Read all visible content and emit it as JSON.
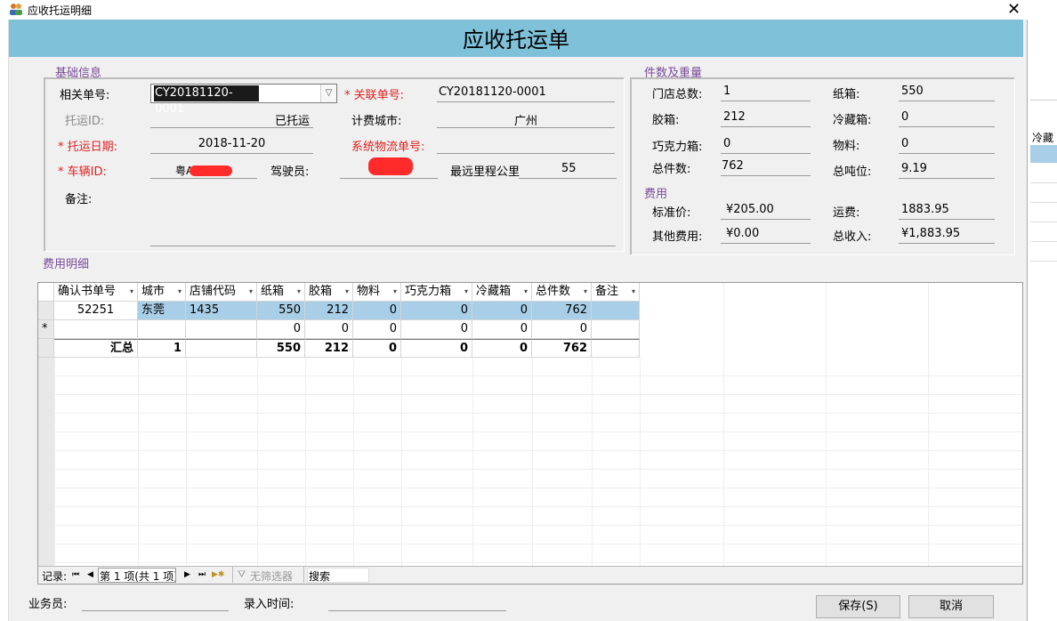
{
  "window": {
    "title": "应收托运明细",
    "close": "✕"
  },
  "header": {
    "title": "应收托运单"
  },
  "basic": {
    "section": "基础信息",
    "related_no_label": "相关单号:",
    "related_no_value": "CY20181120-0001",
    "linked_no_label": "* 关联单号:",
    "linked_no_value": "CY20181120-0001",
    "ship_id_label": "托运ID:",
    "ship_id_value": "已托运",
    "billing_city_label": "计费城市:",
    "billing_city_value": "广州",
    "ship_date_label": "* 托运日期:",
    "ship_date_value": "2018-11-20",
    "logistics_no_label": "系统物流单号:",
    "logistics_no_value": "",
    "vehicle_label": "* 车辆ID:",
    "vehicle_value": "粤A",
    "driver_label": "驾驶员:",
    "driver_value": "",
    "max_km_label": "最远里程公里",
    "max_km_value": "55",
    "remark_label": "备注:",
    "remark_value": ""
  },
  "pieces": {
    "section": "件数及重量",
    "store_total_label": "门店总数:",
    "store_total": "1",
    "carton_label": "纸箱:",
    "carton": "550",
    "rubber_label": "胶箱:",
    "rubber": "212",
    "cold_label": "冷藏箱:",
    "cold": "0",
    "choco_label": "巧克力箱:",
    "choco": "0",
    "material_label": "物料:",
    "material": "0",
    "total_pcs_label": "总件数:",
    "total_pcs": "762",
    "total_ton_label": "总吨位:",
    "total_ton": "9.19"
  },
  "fees": {
    "section": "费用",
    "std_price_label": "标准价:",
    "std_price": "¥205.00",
    "freight_label": "运费:",
    "freight": "1883.95",
    "other_label": "其他费用:",
    "other": "¥0.00",
    "total_income_label": "总收入:",
    "total_income": "¥1,883.95"
  },
  "detail": {
    "section": "费用明细",
    "columns": [
      "确认书单号",
      "城市",
      "店铺代码",
      "纸箱",
      "胶箱",
      "物料",
      "巧克力箱",
      "冷藏箱",
      "总件数",
      "备注"
    ],
    "row1": [
      "52251",
      "东莞",
      "1435",
      "550",
      "212",
      "0",
      "0",
      "0",
      "762",
      ""
    ],
    "new_row_marker": "*",
    "new_row": [
      "",
      "",
      "",
      "0",
      "0",
      "0",
      "0",
      "0",
      "0",
      ""
    ],
    "total_label": "汇总",
    "totals": [
      "1",
      "",
      "550",
      "212",
      "0",
      "0",
      "0",
      "762",
      ""
    ]
  },
  "navigator": {
    "record_label": "记录:",
    "first": "⏮",
    "prev": "◀",
    "position": "第 1 项(共 1 项)",
    "next": "▶",
    "last": "⏭",
    "new": "▶✱",
    "filter": "无筛选器",
    "search": "搜索"
  },
  "footer": {
    "salesman_label": "业务员:",
    "salesman": "",
    "entry_time_label": "录入时间:",
    "entry_time": "",
    "save": "保存(S)",
    "cancel": "取消"
  },
  "background": {
    "right_header": "冷藏"
  }
}
